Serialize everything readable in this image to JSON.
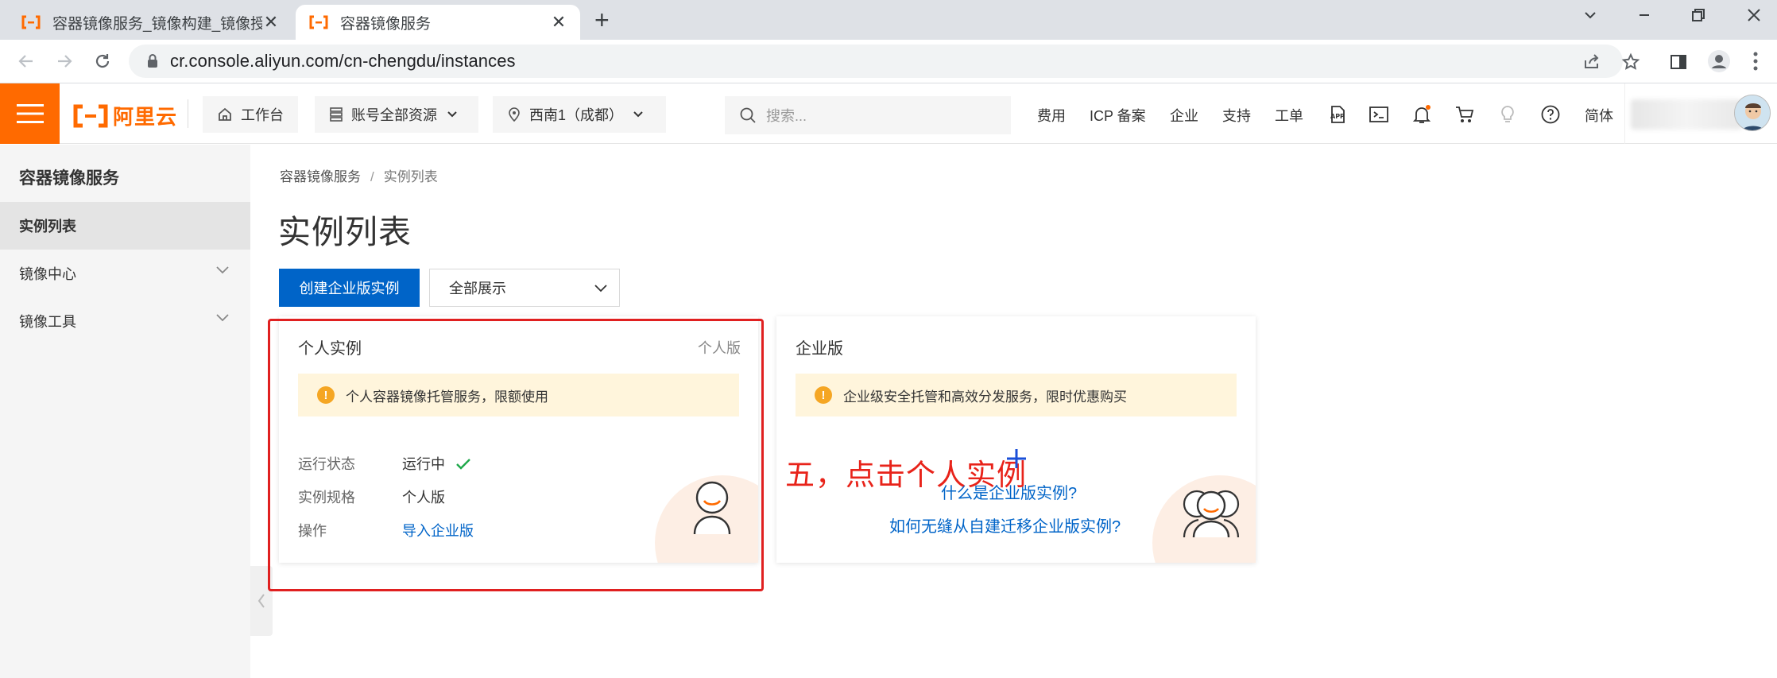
{
  "browser": {
    "tabs": [
      {
        "title": "容器镜像服务_镜像构建_镜像授权",
        "active": false
      },
      {
        "title": "容器镜像服务",
        "active": true
      }
    ],
    "tab_close_glyph": "✕",
    "new_tab_glyph": "+",
    "url": "cr.console.aliyun.com/cn-chengdu/instances",
    "window_controls": {
      "minimize": "⌵",
      "restore": "—",
      "maximize": "❐",
      "close": "✕"
    }
  },
  "topbar": {
    "logo_text": "阿里云",
    "workbench": "工作台",
    "account_resources": "账号全部资源",
    "region": "西南1（成都）",
    "search_placeholder": "搜索...",
    "links": [
      "费用",
      "ICP 备案",
      "企业",
      "支持",
      "工单"
    ],
    "language": "简体",
    "brand_color": "#ff6a00"
  },
  "sidebar": {
    "title": "容器镜像服务",
    "items": [
      {
        "label": "实例列表",
        "active": true,
        "expandable": false
      },
      {
        "label": "镜像中心",
        "active": false,
        "expandable": true
      },
      {
        "label": "镜像工具",
        "active": false,
        "expandable": true
      }
    ]
  },
  "main": {
    "breadcrumb": [
      "容器镜像服务",
      "实例列表"
    ],
    "breadcrumb_sep": "/",
    "page_title": "实例列表",
    "create_button": "创建企业版实例",
    "filter_value": "全部展示",
    "personal_card": {
      "title": "个人实例",
      "tag": "个人版",
      "notice": "个人容器镜像托管服务，限额使用",
      "fields": [
        {
          "key": "运行状态",
          "value": "运行中",
          "status_ok": true
        },
        {
          "key": "实例规格",
          "value": "个人版"
        },
        {
          "key": "操作",
          "value": "导入企业版",
          "is_link": true
        }
      ]
    },
    "enterprise_card": {
      "title": "企业版",
      "notice": "企业级安全托管和高效分发服务，限时优惠购买",
      "links": [
        "什么是企业版实例?",
        "如何无缝从自建迁移企业版实例?"
      ]
    },
    "annotation": "五，点击个人实例",
    "primary_color": "#0064c8",
    "annotation_color": "#e8231a"
  }
}
